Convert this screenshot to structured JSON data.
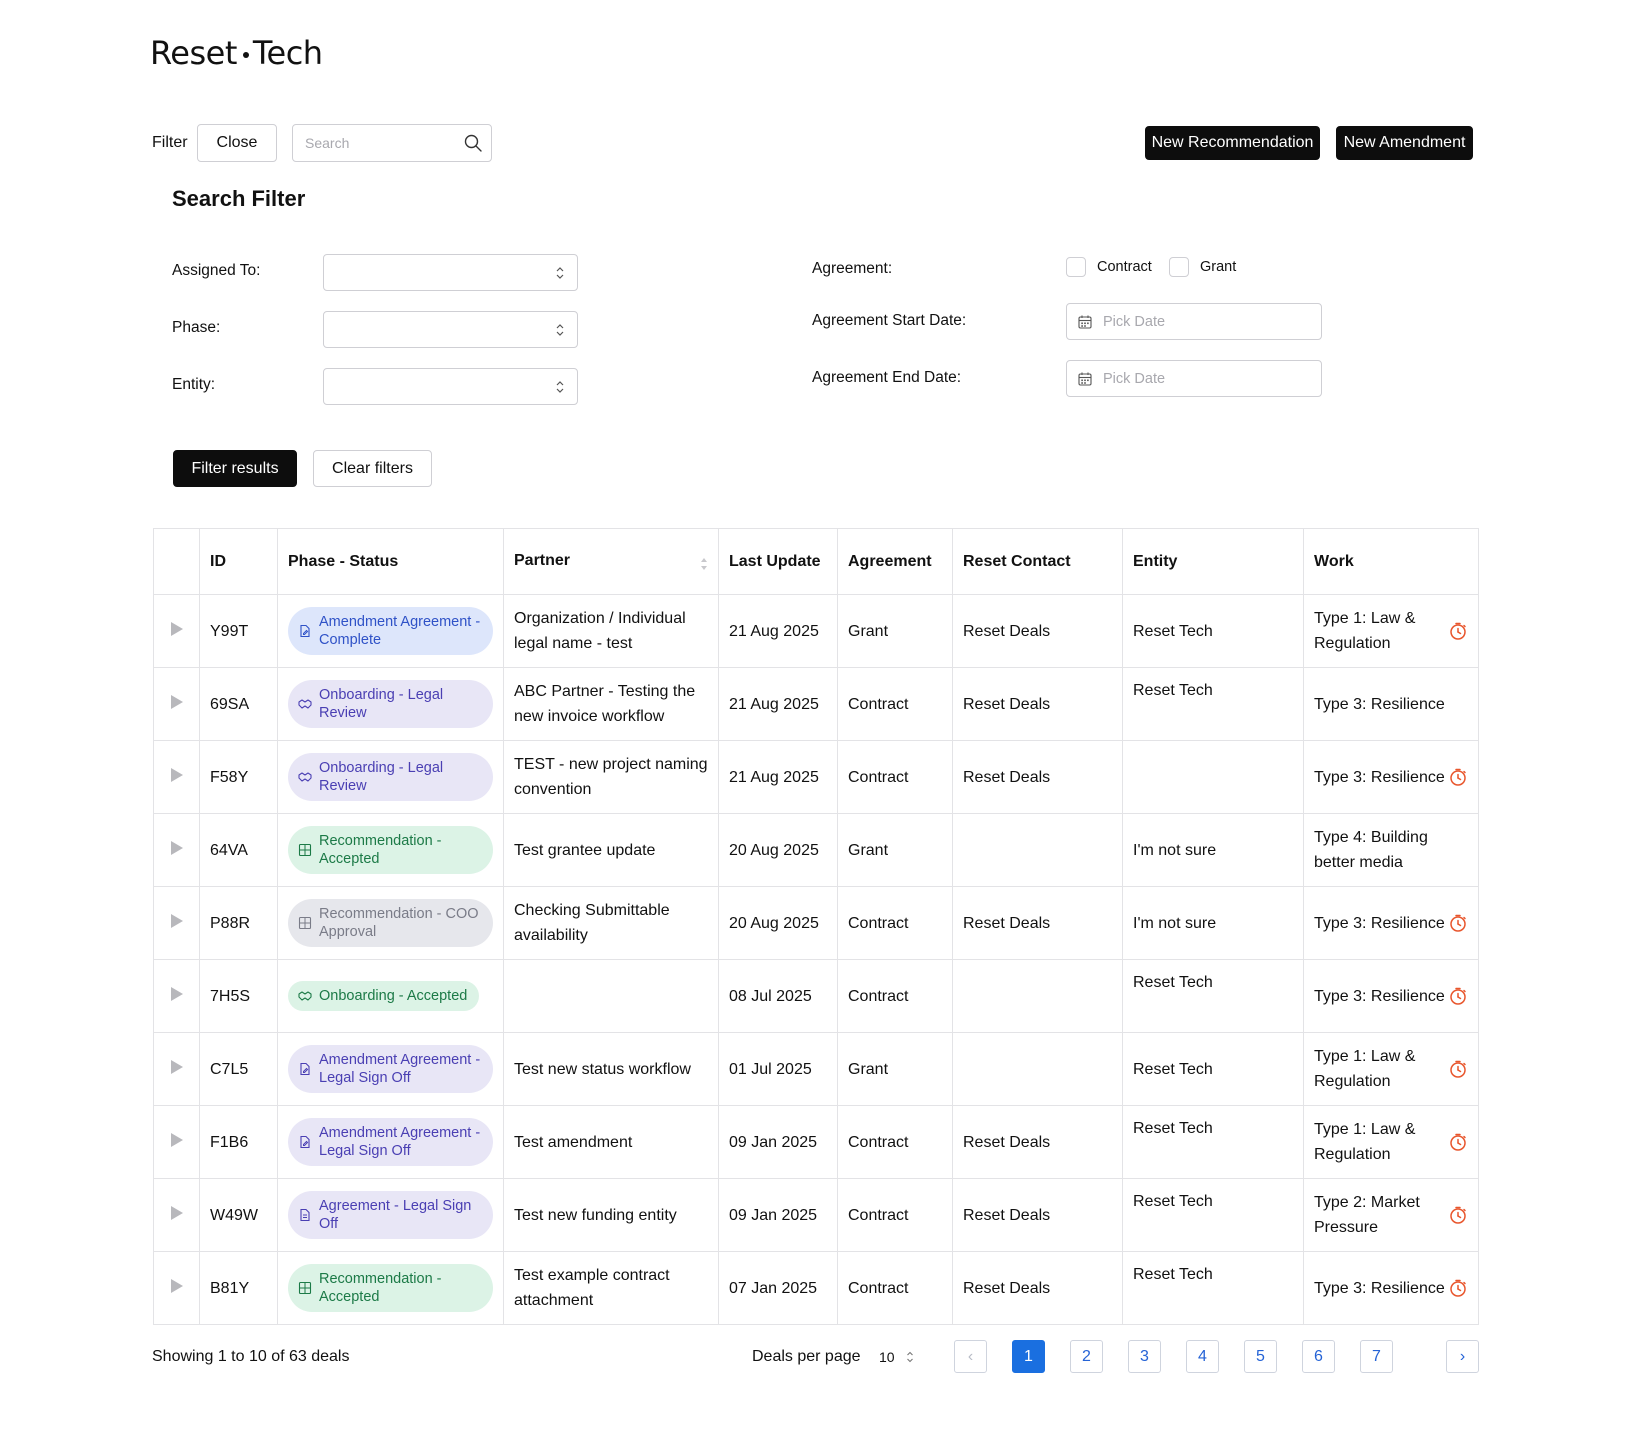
{
  "brand": {
    "left": "Reset",
    "right": "Tech"
  },
  "toolbar": {
    "filter_label": "Filter",
    "close_label": "Close",
    "search_placeholder": "Search",
    "new_recommendation": "New Recommendation",
    "new_amendment": "New Amendment"
  },
  "search_filter": {
    "title": "Search Filter",
    "assigned_to_label": "Assigned To:",
    "phase_label": "Phase:",
    "entity_label": "Entity:",
    "agreement_label": "Agreement:",
    "contract_label": "Contract",
    "grant_label": "Grant",
    "start_date_label": "Agreement Start Date:",
    "end_date_label": "Agreement End Date:",
    "date_placeholder": "Pick Date",
    "filter_results": "Filter results",
    "clear_filters": "Clear filters"
  },
  "table": {
    "headers": {
      "id": "ID",
      "phase_status": "Phase - Status",
      "partner": "Partner",
      "last_update": "Last Update",
      "agreement": "Agreement",
      "reset_contact": "Reset Contact",
      "entity": "Entity",
      "work": "Work"
    },
    "rows": [
      {
        "id": "Y99T",
        "status": "Amendment Agreement - Complete",
        "status_color": "blue",
        "status_icon": "document-edit-icon",
        "partner": "Organization / Individual legal name - test",
        "last_update": "21 Aug 2025",
        "agreement": "Grant",
        "contact": "Reset Deals",
        "entity": "Reset Tech",
        "work": "Type 1: Law & Regulation",
        "timer": true
      },
      {
        "id": "69SA",
        "status": "Onboarding - Legal Review",
        "status_color": "purple",
        "status_icon": "handshake-icon",
        "partner": "ABC Partner - Testing the new invoice workflow",
        "last_update": "21 Aug 2025",
        "agreement": "Contract",
        "contact": "Reset Deals",
        "entity": "Reset Tech",
        "work": "Type 3: Resilience",
        "timer": false
      },
      {
        "id": "F58Y",
        "status": "Onboarding - Legal Review",
        "status_color": "purple",
        "status_icon": "handshake-icon",
        "partner": "TEST - new project naming convention",
        "last_update": "21 Aug 2025",
        "agreement": "Contract",
        "contact": "Reset Deals",
        "entity": "",
        "work": "Type 3: Resilience",
        "timer": true
      },
      {
        "id": "64VA",
        "status": "Recommendation - Accepted",
        "status_color": "green",
        "status_icon": "grid-plus-icon",
        "partner": "Test grantee update",
        "last_update": "20 Aug 2025",
        "agreement": "Grant",
        "contact": "",
        "entity": "I'm not sure",
        "work": "Type 4: Building better media",
        "timer": false
      },
      {
        "id": "P88R",
        "status": "Recommendation - COO Approval",
        "status_color": "gray",
        "status_icon": "grid-plus-icon",
        "partner": "Checking Submittable availability",
        "last_update": "20 Aug 2025",
        "agreement": "Contract",
        "contact": "Reset Deals",
        "entity": "I'm not sure",
        "work": "Type 3: Resilience",
        "timer": true
      },
      {
        "id": "7H5S",
        "status": "Onboarding - Accepted",
        "status_color": "green",
        "status_icon": "handshake-icon",
        "partner": "",
        "last_update": "08 Jul 2025",
        "agreement": "Contract",
        "contact": "",
        "entity": "Reset Tech",
        "work": "Type 3: Resilience",
        "timer": true
      },
      {
        "id": "C7L5",
        "status": "Amendment Agreement - Legal Sign Off",
        "status_color": "purple",
        "status_icon": "document-edit-icon",
        "partner": "Test new status workflow",
        "last_update": "01 Jul 2025",
        "agreement": "Grant",
        "contact": "",
        "entity": "Reset Tech",
        "work": "Type 1: Law & Regulation",
        "timer": true
      },
      {
        "id": "F1B6",
        "status": "Amendment Agreement - Legal Sign Off",
        "status_color": "purple",
        "status_icon": "document-edit-icon",
        "partner": "Test amendment",
        "last_update": "09 Jan 2025",
        "agreement": "Contract",
        "contact": "Reset Deals",
        "entity": "Reset Tech",
        "work": "Type 1: Law & Regulation",
        "timer": true
      },
      {
        "id": "W49W",
        "status": "Agreement - Legal Sign Off",
        "status_color": "purple",
        "status_icon": "document-icon",
        "partner": "Test new funding entity",
        "last_update": "09 Jan 2025",
        "agreement": "Contract",
        "contact": "Reset Deals",
        "entity": "Reset Tech",
        "work": "Type 2: Market Pressure",
        "timer": true
      },
      {
        "id": "B81Y",
        "status": "Recommendation - Accepted",
        "status_color": "green",
        "status_icon": "grid-plus-icon",
        "partner": "Test example contract attachment",
        "last_update": "07 Jan 2025",
        "agreement": "Contract",
        "contact": "Reset Deals",
        "entity": "Reset Tech",
        "work": "Type 3: Resilience",
        "timer": true
      }
    ]
  },
  "footer": {
    "showing": "Showing 1 to 10 of 63 deals",
    "deals_per_page_label": "Deals per page",
    "deals_per_page_value": "10",
    "pages": [
      "1",
      "2",
      "3",
      "4",
      "5",
      "6",
      "7"
    ],
    "current_page": "1",
    "prev_glyph": "‹",
    "next_glyph": "›"
  },
  "colors": {
    "primary_button": "#0d0d0d",
    "active_page": "#1a6fe0",
    "timer": "#e8552c"
  }
}
